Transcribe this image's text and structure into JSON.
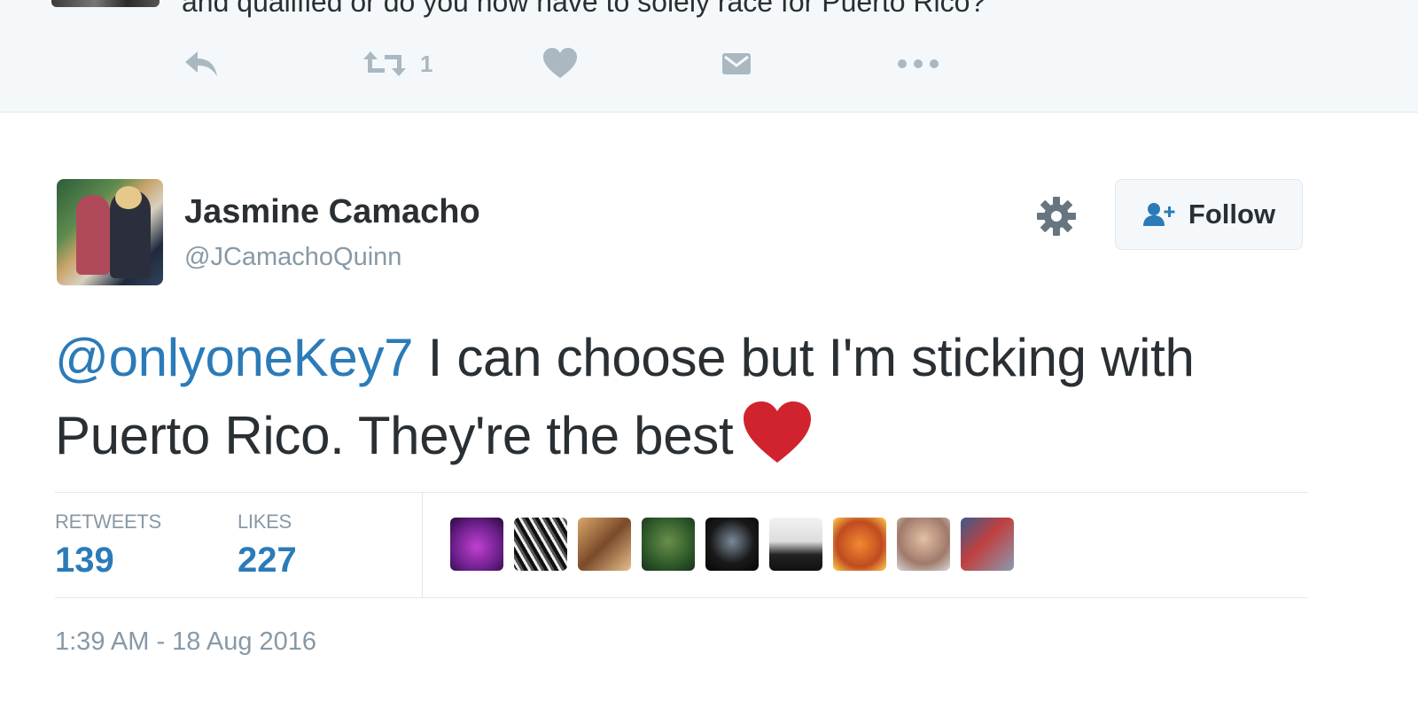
{
  "parent_tweet": {
    "text_fragment": "and qualified or do you now have to solely race for Puerto Rico?",
    "actions": {
      "reply_icon": "reply-icon",
      "retweet_icon": "retweet-icon",
      "retweet_count": "1",
      "like_icon": "heart-icon",
      "dm_icon": "direct-message-icon",
      "more_icon": "more-icon"
    }
  },
  "tweet": {
    "author": {
      "name": "Jasmine Camacho",
      "handle": "@JCamachoQuinn"
    },
    "follow_label": "Follow",
    "text": {
      "mention": "@onlyoneKey7",
      "body": " I can choose but I'm sticking with Puerto Rico. They're the best"
    },
    "stats": {
      "retweets_label": "RETWEETS",
      "retweets": "139",
      "likes_label": "LIKES",
      "likes": "227"
    },
    "timestamp": "1:39 AM - 18 Aug 2016"
  },
  "colors": {
    "link": "#2b7bb9",
    "muted": "#8899a6",
    "text": "#292f33",
    "heart_emoji": "#d0232e"
  }
}
